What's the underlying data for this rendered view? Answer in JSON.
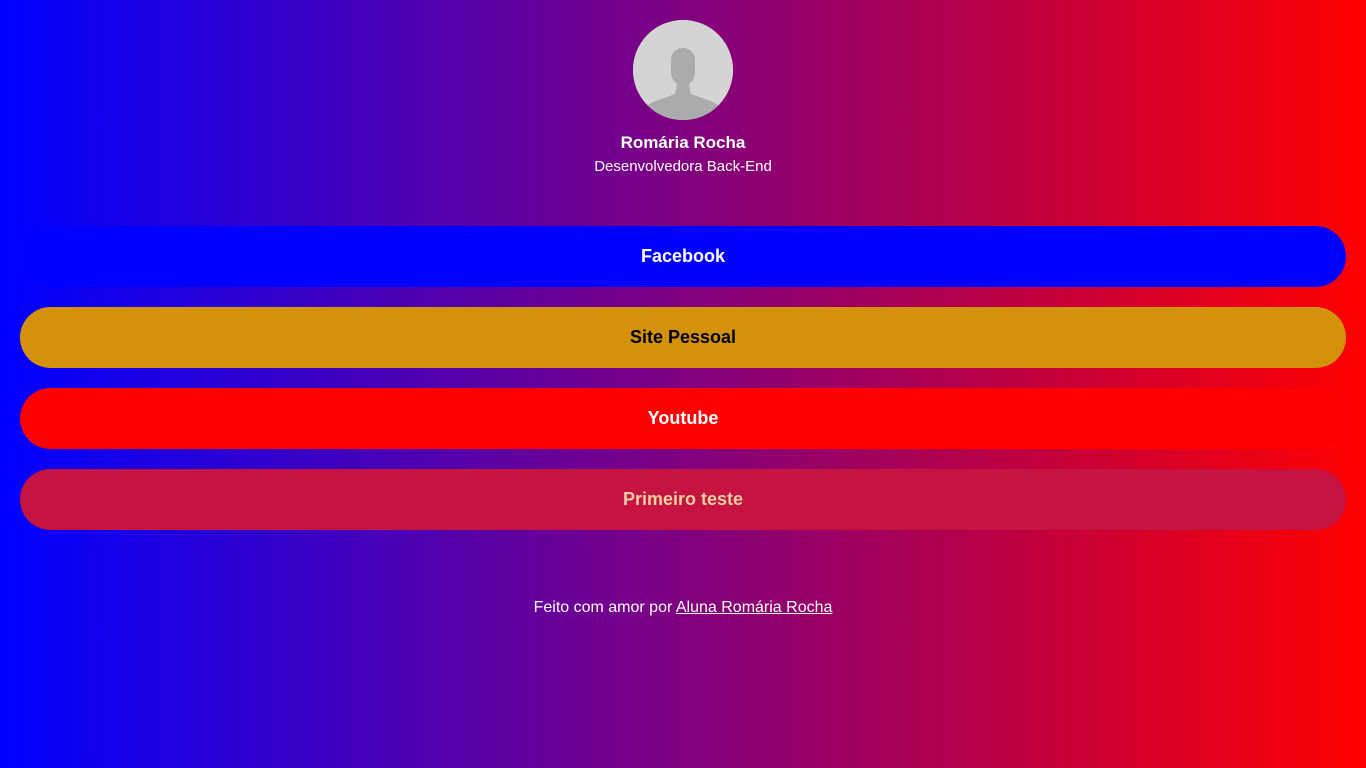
{
  "profile": {
    "avatar_icon": "user-silhouette-icon",
    "name": "Romária Rocha",
    "role": "Desenvolvedora Back-End"
  },
  "links": [
    {
      "label": "Facebook",
      "background": "#0000ff",
      "color": "#ffffff"
    },
    {
      "label": "Site Pessoal",
      "background": "#d4920a",
      "color": "#000000"
    },
    {
      "label": "Youtube",
      "background": "#ff0000",
      "color": "#ffffff"
    },
    {
      "label": "Primeiro teste",
      "background": "#c51442",
      "color": "#e8cfa0"
    }
  ],
  "footer": {
    "text": "Feito com amor por",
    "link_label": "Aluna Romária Rocha"
  },
  "colors": {
    "gradient_start": "#0000ff",
    "gradient_end": "#ff0000"
  }
}
